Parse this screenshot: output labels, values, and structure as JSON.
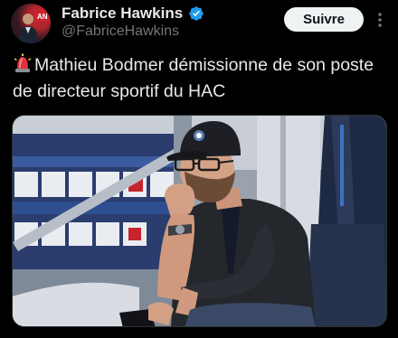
{
  "author": {
    "display_name": "Fabrice Hawkins",
    "handle": "@FabriceHawkins",
    "verified_icon": "verified-badge-icon",
    "avatar_icon": "avatar-photo"
  },
  "actions": {
    "follow_label": "Suivre",
    "more_icon": "more-vertical-icon"
  },
  "tweet": {
    "emoji_icon": "police-siren-icon",
    "text": "Mathieu Bodmer démissionne de son poste de directeur sportif du HAC"
  },
  "media": {
    "type": "photo",
    "subject": "man in cap and glasses seated in stadium stands"
  },
  "colors": {
    "background": "#000000",
    "text": "#e7e9ea",
    "secondary_text": "#71767b",
    "verified_blue": "#1d9bf0",
    "follow_button_bg": "#eff3f4",
    "follow_button_text": "#0f1419"
  }
}
